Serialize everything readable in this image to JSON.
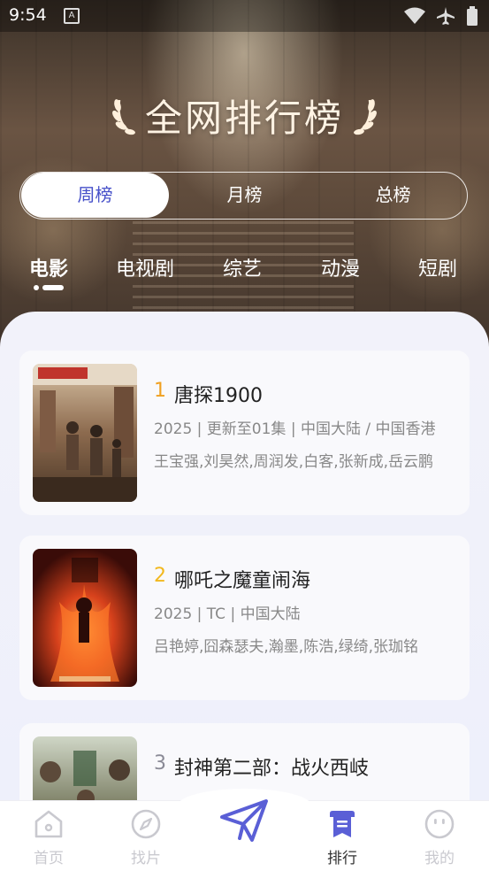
{
  "status_bar": {
    "time": "9:54",
    "a_icon": "A"
  },
  "header": {
    "title": "全网排行榜"
  },
  "period_tabs": [
    {
      "label": "周榜",
      "active": true
    },
    {
      "label": "月榜",
      "active": false
    },
    {
      "label": "总榜",
      "active": false
    }
  ],
  "category_tabs": [
    {
      "label": "电影",
      "active": true
    },
    {
      "label": "电视剧",
      "active": false
    },
    {
      "label": "综艺",
      "active": false
    },
    {
      "label": "动漫",
      "active": false
    },
    {
      "label": "短剧",
      "active": false
    }
  ],
  "list": [
    {
      "rank": "1",
      "title": "唐探1900",
      "meta": "2025 | 更新至01集 | 中国大陆 / 中国香港",
      "cast": "王宝强,刘昊然,周润发,白客,张新成,岳云鹏",
      "rank_color": "#f0a020"
    },
    {
      "rank": "2",
      "title": "哪吒之魔童闹海",
      "meta": "2025 | TC | 中国大陆",
      "cast": "吕艳婷,囧森瑟夫,瀚墨,陈浩,绿绮,张珈铭",
      "rank_color": "#f2b81e"
    },
    {
      "rank": "3",
      "title": "封神第二部：战火西岐",
      "meta": "",
      "cast": "",
      "rank_color": "#8a8a96"
    }
  ],
  "bottom_nav": [
    {
      "label": "首页",
      "icon": "home-icon",
      "active": false
    },
    {
      "label": "找片",
      "icon": "compass-icon",
      "active": false
    },
    {
      "label": "",
      "icon": "paper-plane-icon",
      "active": false
    },
    {
      "label": "排行",
      "icon": "ranking-icon",
      "active": true
    },
    {
      "label": "我的",
      "icon": "profile-face-icon",
      "active": false
    }
  ],
  "colors": {
    "accent": "#4650c9",
    "nav_active": "#5a5fd6",
    "nav_inactive": "#c9c9cf"
  }
}
